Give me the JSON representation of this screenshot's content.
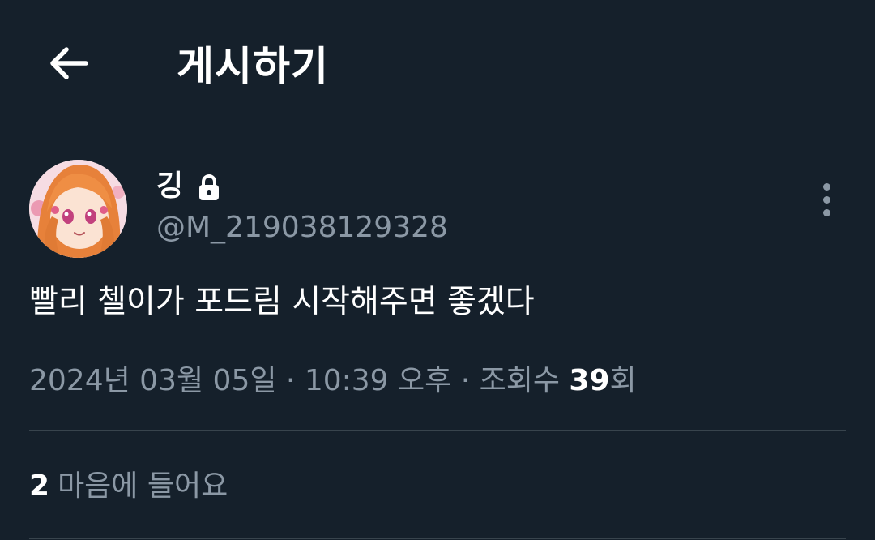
{
  "header": {
    "back_icon": "arrow-left-icon",
    "title": "게시하기"
  },
  "author": {
    "display_name": "깅",
    "protected_icon": "lock-icon",
    "handle": "@M_219038129328",
    "avatar": "anime-character-avatar"
  },
  "more_icon": "more-vertical-icon",
  "tweet": {
    "text": "빨리 첼이가 포드림 시작해주면 좋겠다"
  },
  "meta": {
    "date": "2024년 03월 05일",
    "separator_1": " · ",
    "time": "10:39 오후",
    "separator_2": " · ",
    "views_label": "조회수 ",
    "views_count": "39",
    "views_suffix": "회"
  },
  "stats": {
    "likes_count": "2",
    "likes_label": "마음에 들어요"
  },
  "colors": {
    "background": "#15202b",
    "text_primary": "#ffffff",
    "text_secondary": "#8b98a5",
    "border": "#38444d"
  }
}
